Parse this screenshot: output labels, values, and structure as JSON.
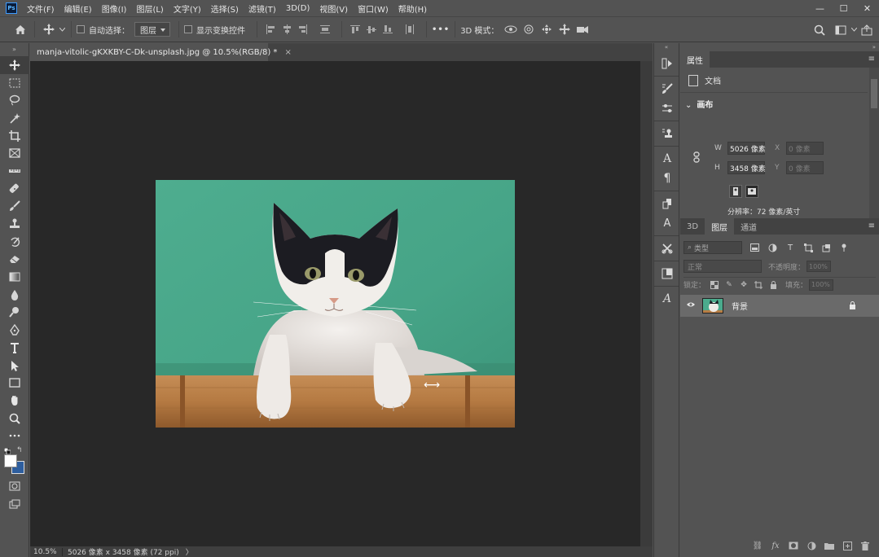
{
  "app": {
    "logo": "Ps"
  },
  "menu": [
    "文件(F)",
    "编辑(E)",
    "图像(I)",
    "图层(L)",
    "文字(Y)",
    "选择(S)",
    "滤镜(T)",
    "3D(D)",
    "视图(V)",
    "窗口(W)",
    "帮助(H)"
  ],
  "window_controls": {
    "minimize": "—",
    "maximize": "☐",
    "close": "✕"
  },
  "options": {
    "auto_select_label": "自动选择：",
    "auto_select_value": "图层",
    "show_transform_label": "显示变换控件",
    "more": "•••",
    "mode_3d_label": "3D 模式："
  },
  "document": {
    "tab_title": "manja-vitolic-gKXKBY-C-Dk-unsplash.jpg @ 10.5%(RGB/8) *",
    "tab_close": "×"
  },
  "status": {
    "zoom": "10.5%",
    "info": "5026 像素 x 3458 像素 (72 ppi)",
    "arrow": "〉"
  },
  "properties": {
    "tab": "属性",
    "doc_label": "文档",
    "section": "画布",
    "w_label": "W",
    "w_value": "5026 像素",
    "h_label": "H",
    "h_value": "3458 像素",
    "x_label": "X",
    "x_placeholder": "0 像素",
    "y_label": "Y",
    "y_placeholder": "0 像素",
    "resolution": "分辨率：72 像素/英寸"
  },
  "layers_panel": {
    "tabs": [
      "3D",
      "图层",
      "通道"
    ],
    "active_tab": 1,
    "filter_label": "类型",
    "blend_mode": "正常",
    "opacity_label": "不透明度：",
    "opacity_value": "100%",
    "lock_label": "锁定：",
    "fill_label": "填充：",
    "fill_value": "100%",
    "layers": [
      {
        "name": "背景",
        "visible": true,
        "locked": true
      }
    ]
  },
  "colors": {
    "ui_bg": "#535353",
    "canvas_bg": "#282828",
    "photo_wall": "#4bab8d",
    "wood": "#b87d45",
    "foreground": "#ffffff",
    "background": "#2e5e9e"
  }
}
